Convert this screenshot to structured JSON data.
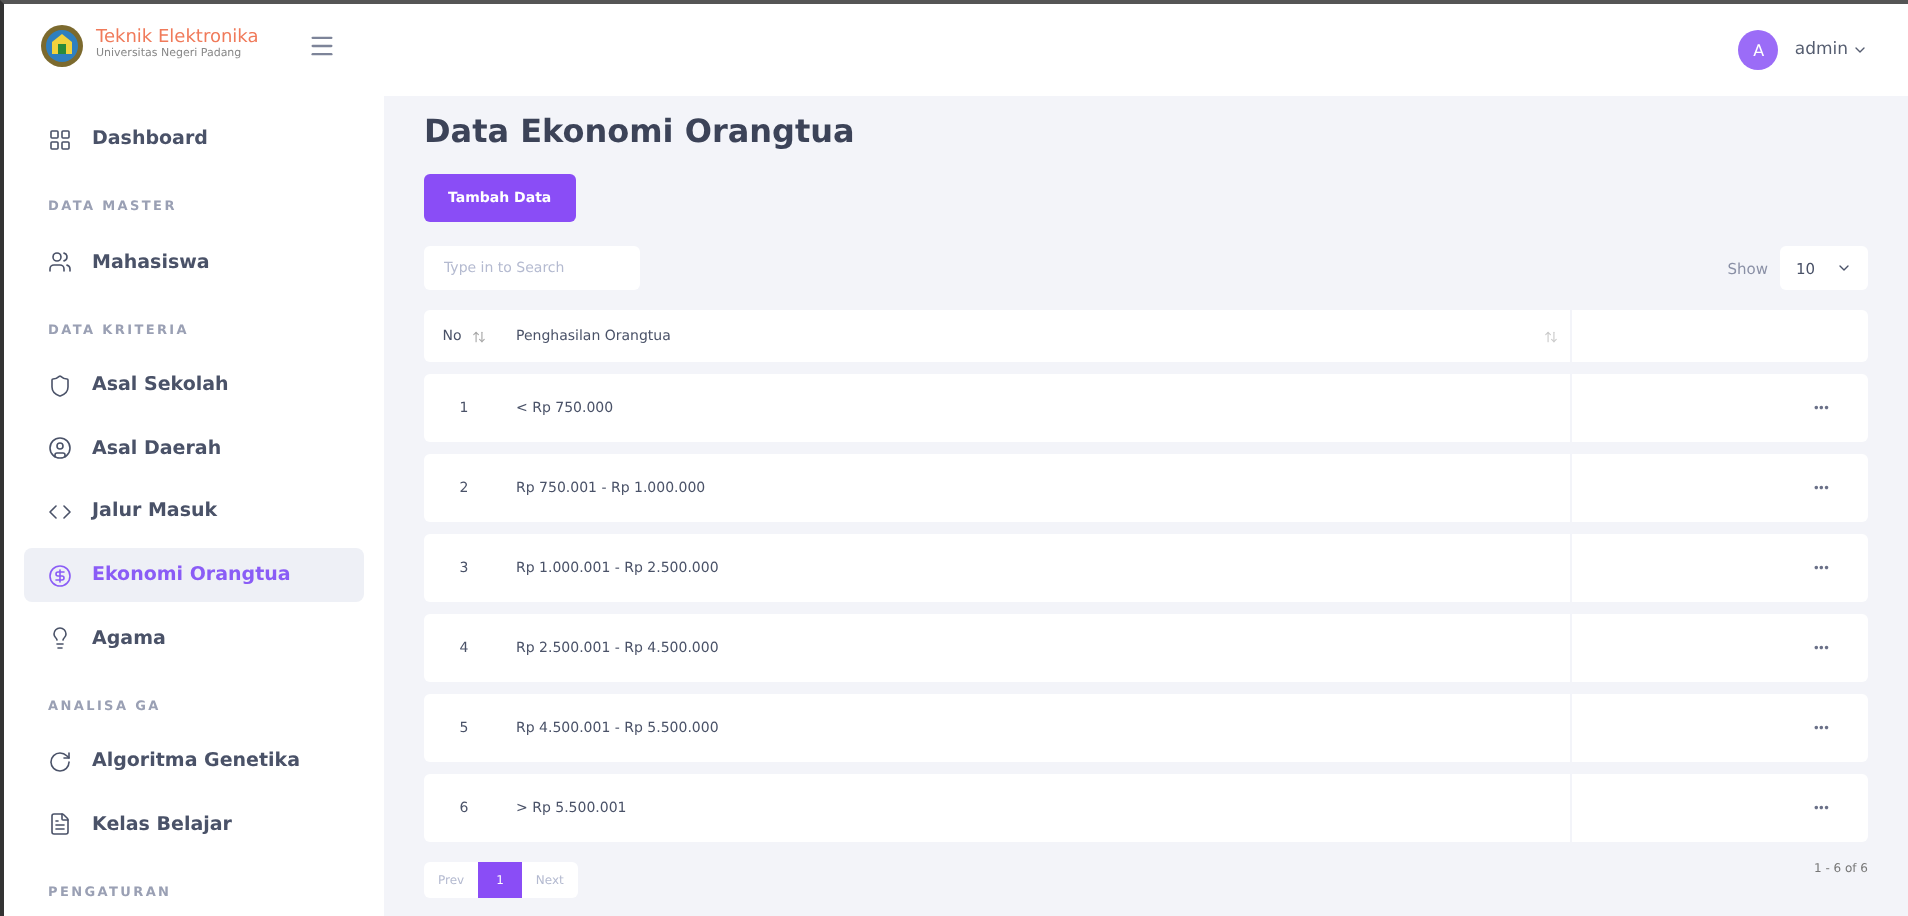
{
  "brand": {
    "title": "Teknik Elektronika",
    "subtitle": "Universitas Negeri Padang"
  },
  "sidebar": {
    "sections": [
      {
        "items": [
          {
            "label": "Dashboard",
            "selected": false
          }
        ]
      },
      {
        "heading": "DATA MASTER",
        "items": [
          {
            "label": "Mahasiswa",
            "selected": false
          }
        ]
      },
      {
        "heading": "DATA KRITERIA",
        "items": [
          {
            "label": "Asal Sekolah",
            "selected": false
          },
          {
            "label": "Asal Daerah",
            "selected": false
          },
          {
            "label": "Jalur Masuk",
            "selected": false
          },
          {
            "label": "Ekonomi Orangtua",
            "selected": true
          },
          {
            "label": "Agama",
            "selected": false
          }
        ]
      },
      {
        "heading": "ANALISA GA",
        "items": [
          {
            "label": "Algoritma Genetika",
            "selected": false
          },
          {
            "label": "Kelas Belajar",
            "selected": false
          }
        ]
      },
      {
        "heading": "PENGATURAN"
      }
    ]
  },
  "user": {
    "initial": "A",
    "name": "admin"
  },
  "page_title": "Data Ekonomi Orangtua",
  "add_button": "Tambah Data",
  "search": {
    "placeholder": "Type in to Search"
  },
  "show": {
    "label": "Show",
    "value": "10"
  },
  "table": {
    "columns": [
      "No",
      "Penghasilan Orangtua"
    ],
    "rows": [
      {
        "no": "1",
        "value": "< Rp 750.000",
        "action": "•••"
      },
      {
        "no": "2",
        "value": "Rp 750.001 - Rp 1.000.000",
        "action": "•••"
      },
      {
        "no": "3",
        "value": "Rp 1.000.001 - Rp 2.500.000",
        "action": "•••"
      },
      {
        "no": "4",
        "value": "Rp 2.500.001 - Rp 4.500.000",
        "action": "•••"
      },
      {
        "no": "5",
        "value": "Rp 4.500.001 - Rp 5.500.000",
        "action": "•••"
      },
      {
        "no": "6",
        "value": "> Rp 5.500.001",
        "action": "•••"
      }
    ]
  },
  "pagination": {
    "pages": [
      {
        "label": "Prev",
        "kind": "nav",
        "selected": false
      },
      {
        "label": "1",
        "kind": "page",
        "selected": true
      },
      {
        "label": "Next",
        "kind": "nav",
        "selected": false
      }
    ],
    "summary": "1 - 6 of 6"
  }
}
